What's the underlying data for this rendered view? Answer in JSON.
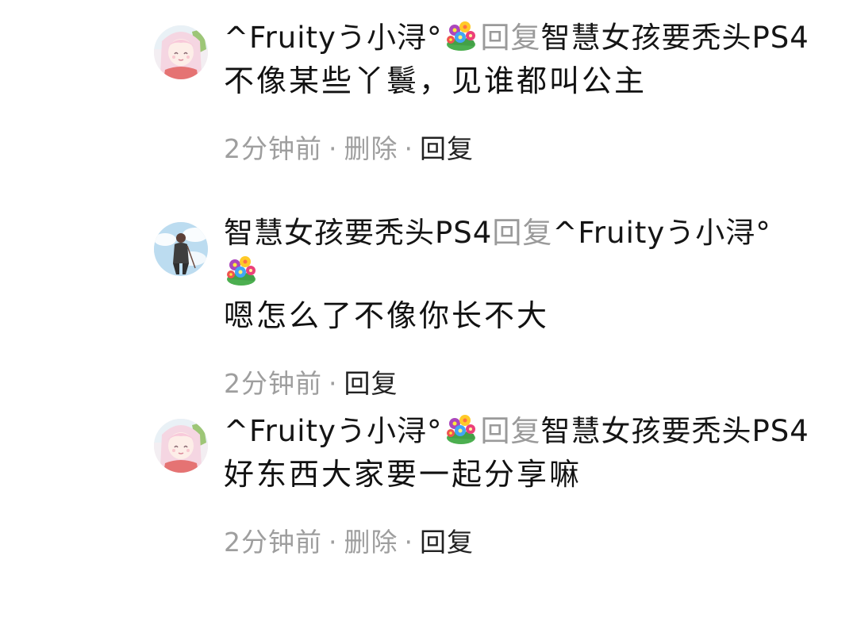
{
  "comments": [
    {
      "author": "^Fruityう小浔°",
      "reply_word": "回复",
      "reply_to": "智慧女孩要秃头PS4",
      "text": "不像某些丫鬟，见谁都叫公主",
      "time": "2分钟前",
      "delete_label": "删除",
      "reply_label": "回复",
      "avatar_icon": "anime-girl-avatar"
    },
    {
      "author": "智慧女孩要秃头PS4",
      "reply_word": "回复",
      "reply_to": "^Fruityう小浔°",
      "text": "嗯怎么了不像你长不大",
      "time": "2分钟前",
      "reply_label": "回复",
      "avatar_icon": "sky-figure-avatar"
    },
    {
      "author": "^Fruityう小浔°",
      "reply_word": "回复",
      "reply_to": "智慧女孩要秃头PS4",
      "text": "好东西大家要一起分享嘛",
      "time": "2分钟前",
      "delete_label": "删除",
      "reply_label": "回复",
      "avatar_icon": "anime-girl-avatar"
    }
  ],
  "separator": "·",
  "colors": {
    "meta_gray": "#9e9e9e",
    "reply_gray": "#9a9a9a",
    "text": "#111111"
  }
}
